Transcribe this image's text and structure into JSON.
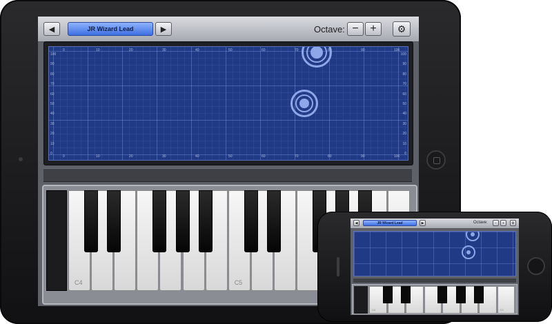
{
  "ipad": {
    "toolbar": {
      "prev_icon": "◀",
      "next_icon": "▶",
      "preset_name": "JR Wizard Lead",
      "octave_label": "Octave:",
      "octave_down": "−",
      "octave_up": "+",
      "settings_icon": "⚙"
    },
    "xy_pad": {
      "top_ticks": [
        "0",
        "10",
        "20",
        "30",
        "40",
        "50",
        "60",
        "70",
        "80",
        "90",
        "100"
      ],
      "side_ticks": [
        "100",
        "90",
        "80",
        "70",
        "60",
        "50",
        "40",
        "30",
        "20",
        "10",
        "0"
      ]
    },
    "keyboard": {
      "c4_label": "C4",
      "c5_label": "C5"
    }
  },
  "iphone": {
    "toolbar": {
      "prev_icon": "◀",
      "next_icon": "▶",
      "preset_name": "JR Wizard Lead",
      "octave_label": "Octave:",
      "octave_down": "−",
      "octave_up": "+",
      "settings_icon": "⚙"
    },
    "keyboard": {
      "c4_label": "C4",
      "c5_label": "C5"
    }
  }
}
